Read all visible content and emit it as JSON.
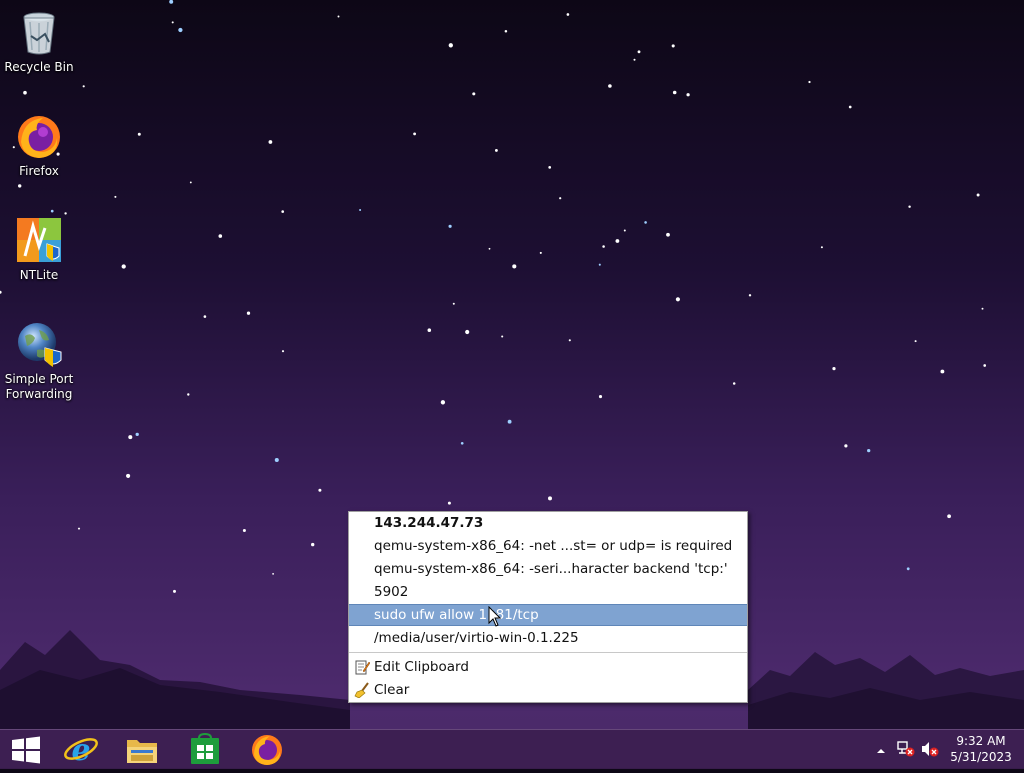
{
  "desktop": {
    "icons": [
      {
        "label": "Recycle Bin",
        "icon": "recycle-bin-icon"
      },
      {
        "label": "Firefox",
        "icon": "firefox-icon"
      },
      {
        "label": "NTLite",
        "icon": "ntlite-icon"
      },
      {
        "label": "Simple Port Forwarding",
        "icon": "globe-shield-icon"
      }
    ]
  },
  "clipboard_menu": {
    "items": [
      {
        "text": "143.244.47.73",
        "bold": true
      },
      {
        "text": "qemu-system-x86_64: -net ...st= or udp= is required"
      },
      {
        "text": "qemu-system-x86_64: -seri...haracter backend 'tcp:'"
      },
      {
        "text": "5902"
      },
      {
        "text": "sudo ufw allow 1181/tcp",
        "highlighted": true
      },
      {
        "text": "/media/user/virtio-win-0.1.225"
      }
    ],
    "actions": [
      {
        "text": "Edit Clipboard",
        "icon": "notepad-edit-icon"
      },
      {
        "text": "Clear",
        "icon": "broom-icon"
      }
    ]
  },
  "taskbar": {
    "pinned": [
      "start-button",
      "internet-explorer-icon",
      "file-explorer-icon",
      "store-icon",
      "firefox-icon"
    ],
    "clock": {
      "time": "9:32 AM",
      "date": "5/31/2023"
    }
  },
  "colors": {
    "highlight": "#7fa3d1",
    "taskbar": "#3c1e50"
  }
}
